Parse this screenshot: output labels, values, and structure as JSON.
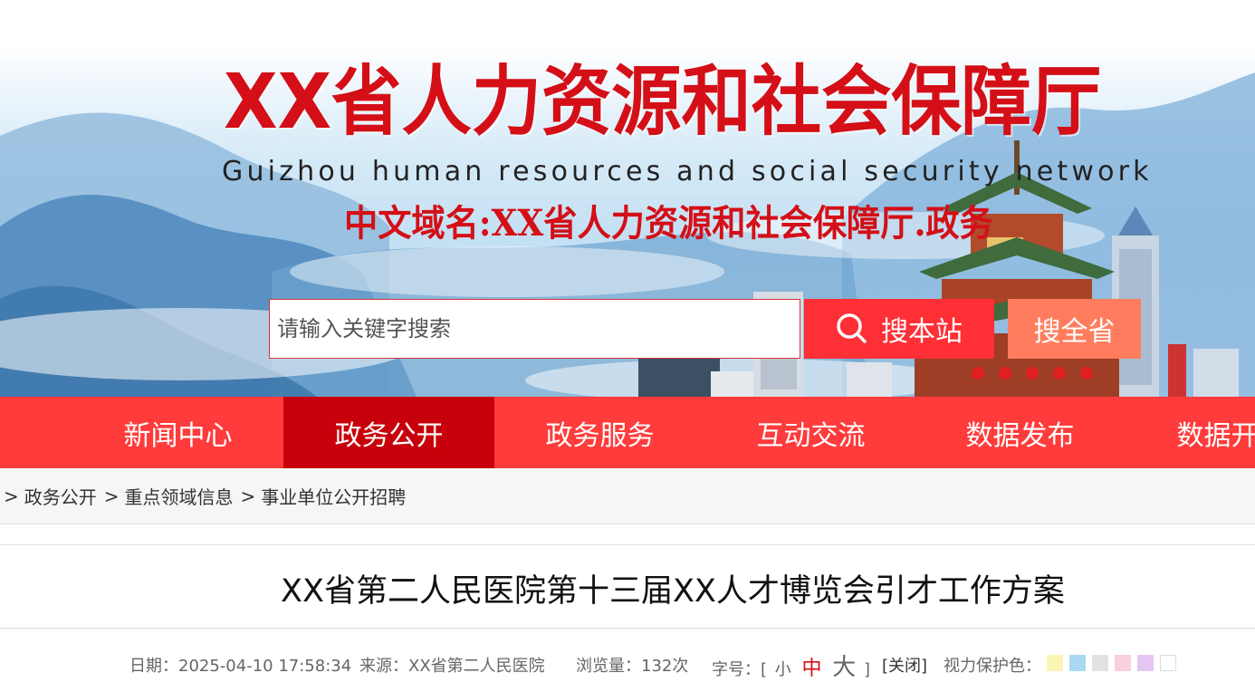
{
  "header": {
    "title": "XX省人力资源和社会保障厅",
    "subtitle": "Guizhou human resources and social security network",
    "domain_text": "中文域名:XX省人力资源和社会保障厅.政务"
  },
  "search": {
    "placeholder": "请输入关键字搜索",
    "site_button": "搜本站",
    "province_button": "搜全省"
  },
  "nav": {
    "items": [
      {
        "label": "新闻中心"
      },
      {
        "label": "政务公开",
        "active": true
      },
      {
        "label": "政务服务"
      },
      {
        "label": "互动交流"
      },
      {
        "label": "数据发布"
      },
      {
        "label": "数据开放"
      }
    ]
  },
  "breadcrumb": {
    "separator": ">",
    "items": [
      "政务公开",
      "重点领域信息",
      "事业单位公开招聘"
    ]
  },
  "article": {
    "title": "XX省第二人民医院第十三届XX人才博览会引才工作方案"
  },
  "meta": {
    "date": "日期：2025-04-10 17:58:34",
    "source": "来源：XX省第二人民医院",
    "views": "浏览量：132次",
    "font_label": "字号：[",
    "font_small": "小",
    "font_medium": "中",
    "font_large": "大",
    "font_close_bracket": "]",
    "close": "[关闭]",
    "eye_label": "视力保护色：",
    "eye_colors": [
      "#faf5b5",
      "#a7d9f2",
      "#e2e2e2",
      "#f9d0db",
      "#e4c6f0",
      "#ffffff"
    ]
  },
  "colors": {
    "brand_red": "#d40f17",
    "nav_red": "#ff3b3b",
    "nav_active": "#c8000b",
    "search_button": "#ff2f36",
    "province_button": "#ff7d5e"
  }
}
